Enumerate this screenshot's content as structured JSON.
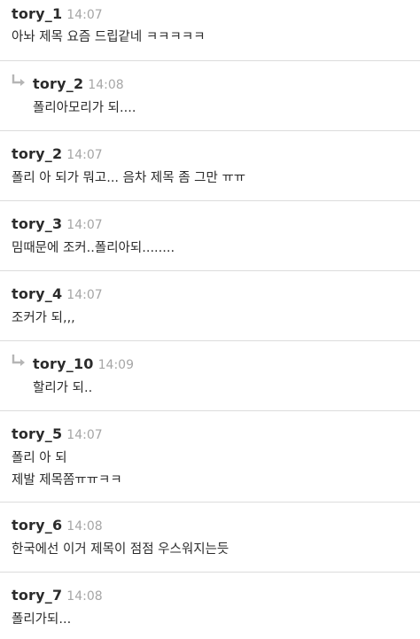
{
  "comments": [
    {
      "nick": "tory_1",
      "time": "14:07",
      "lines": [
        "아놔 제목 요즘 드립같네 ㅋㅋㅋㅋㅋ"
      ],
      "reply": false
    },
    {
      "nick": "tory_2",
      "time": "14:08",
      "lines": [
        "폴리아모리가 되...."
      ],
      "reply": true
    },
    {
      "nick": "tory_2",
      "time": "14:07",
      "lines": [
        "폴리 아 되가 뭐고... 음차 제목 좀 그만 ㅠㅠ"
      ],
      "reply": false
    },
    {
      "nick": "tory_3",
      "time": "14:07",
      "lines": [
        "밈때문에 조커..폴리아되........"
      ],
      "reply": false
    },
    {
      "nick": "tory_4",
      "time": "14:07",
      "lines": [
        "조커가 되,,,"
      ],
      "reply": false
    },
    {
      "nick": "tory_10",
      "time": "14:09",
      "lines": [
        "할리가 되.."
      ],
      "reply": true
    },
    {
      "nick": "tory_5",
      "time": "14:07",
      "lines": [
        "폴리 아 되",
        "제발 제목쫌ㅠㅠㅋㅋ"
      ],
      "reply": false
    },
    {
      "nick": "tory_6",
      "time": "14:08",
      "lines": [
        "한국에선 이거 제목이 점점 우스워지는듯"
      ],
      "reply": false
    },
    {
      "nick": "tory_7",
      "time": "14:08",
      "lines": [
        "폴리가되..."
      ],
      "reply": false
    }
  ],
  "colors": {
    "nick": "#2b2b2b",
    "time": "#a6a6a6",
    "divider": "#dcdcdc",
    "reply_arrow": "#b5b5b5"
  },
  "icons": {
    "reply": "reply-arrow-icon"
  }
}
